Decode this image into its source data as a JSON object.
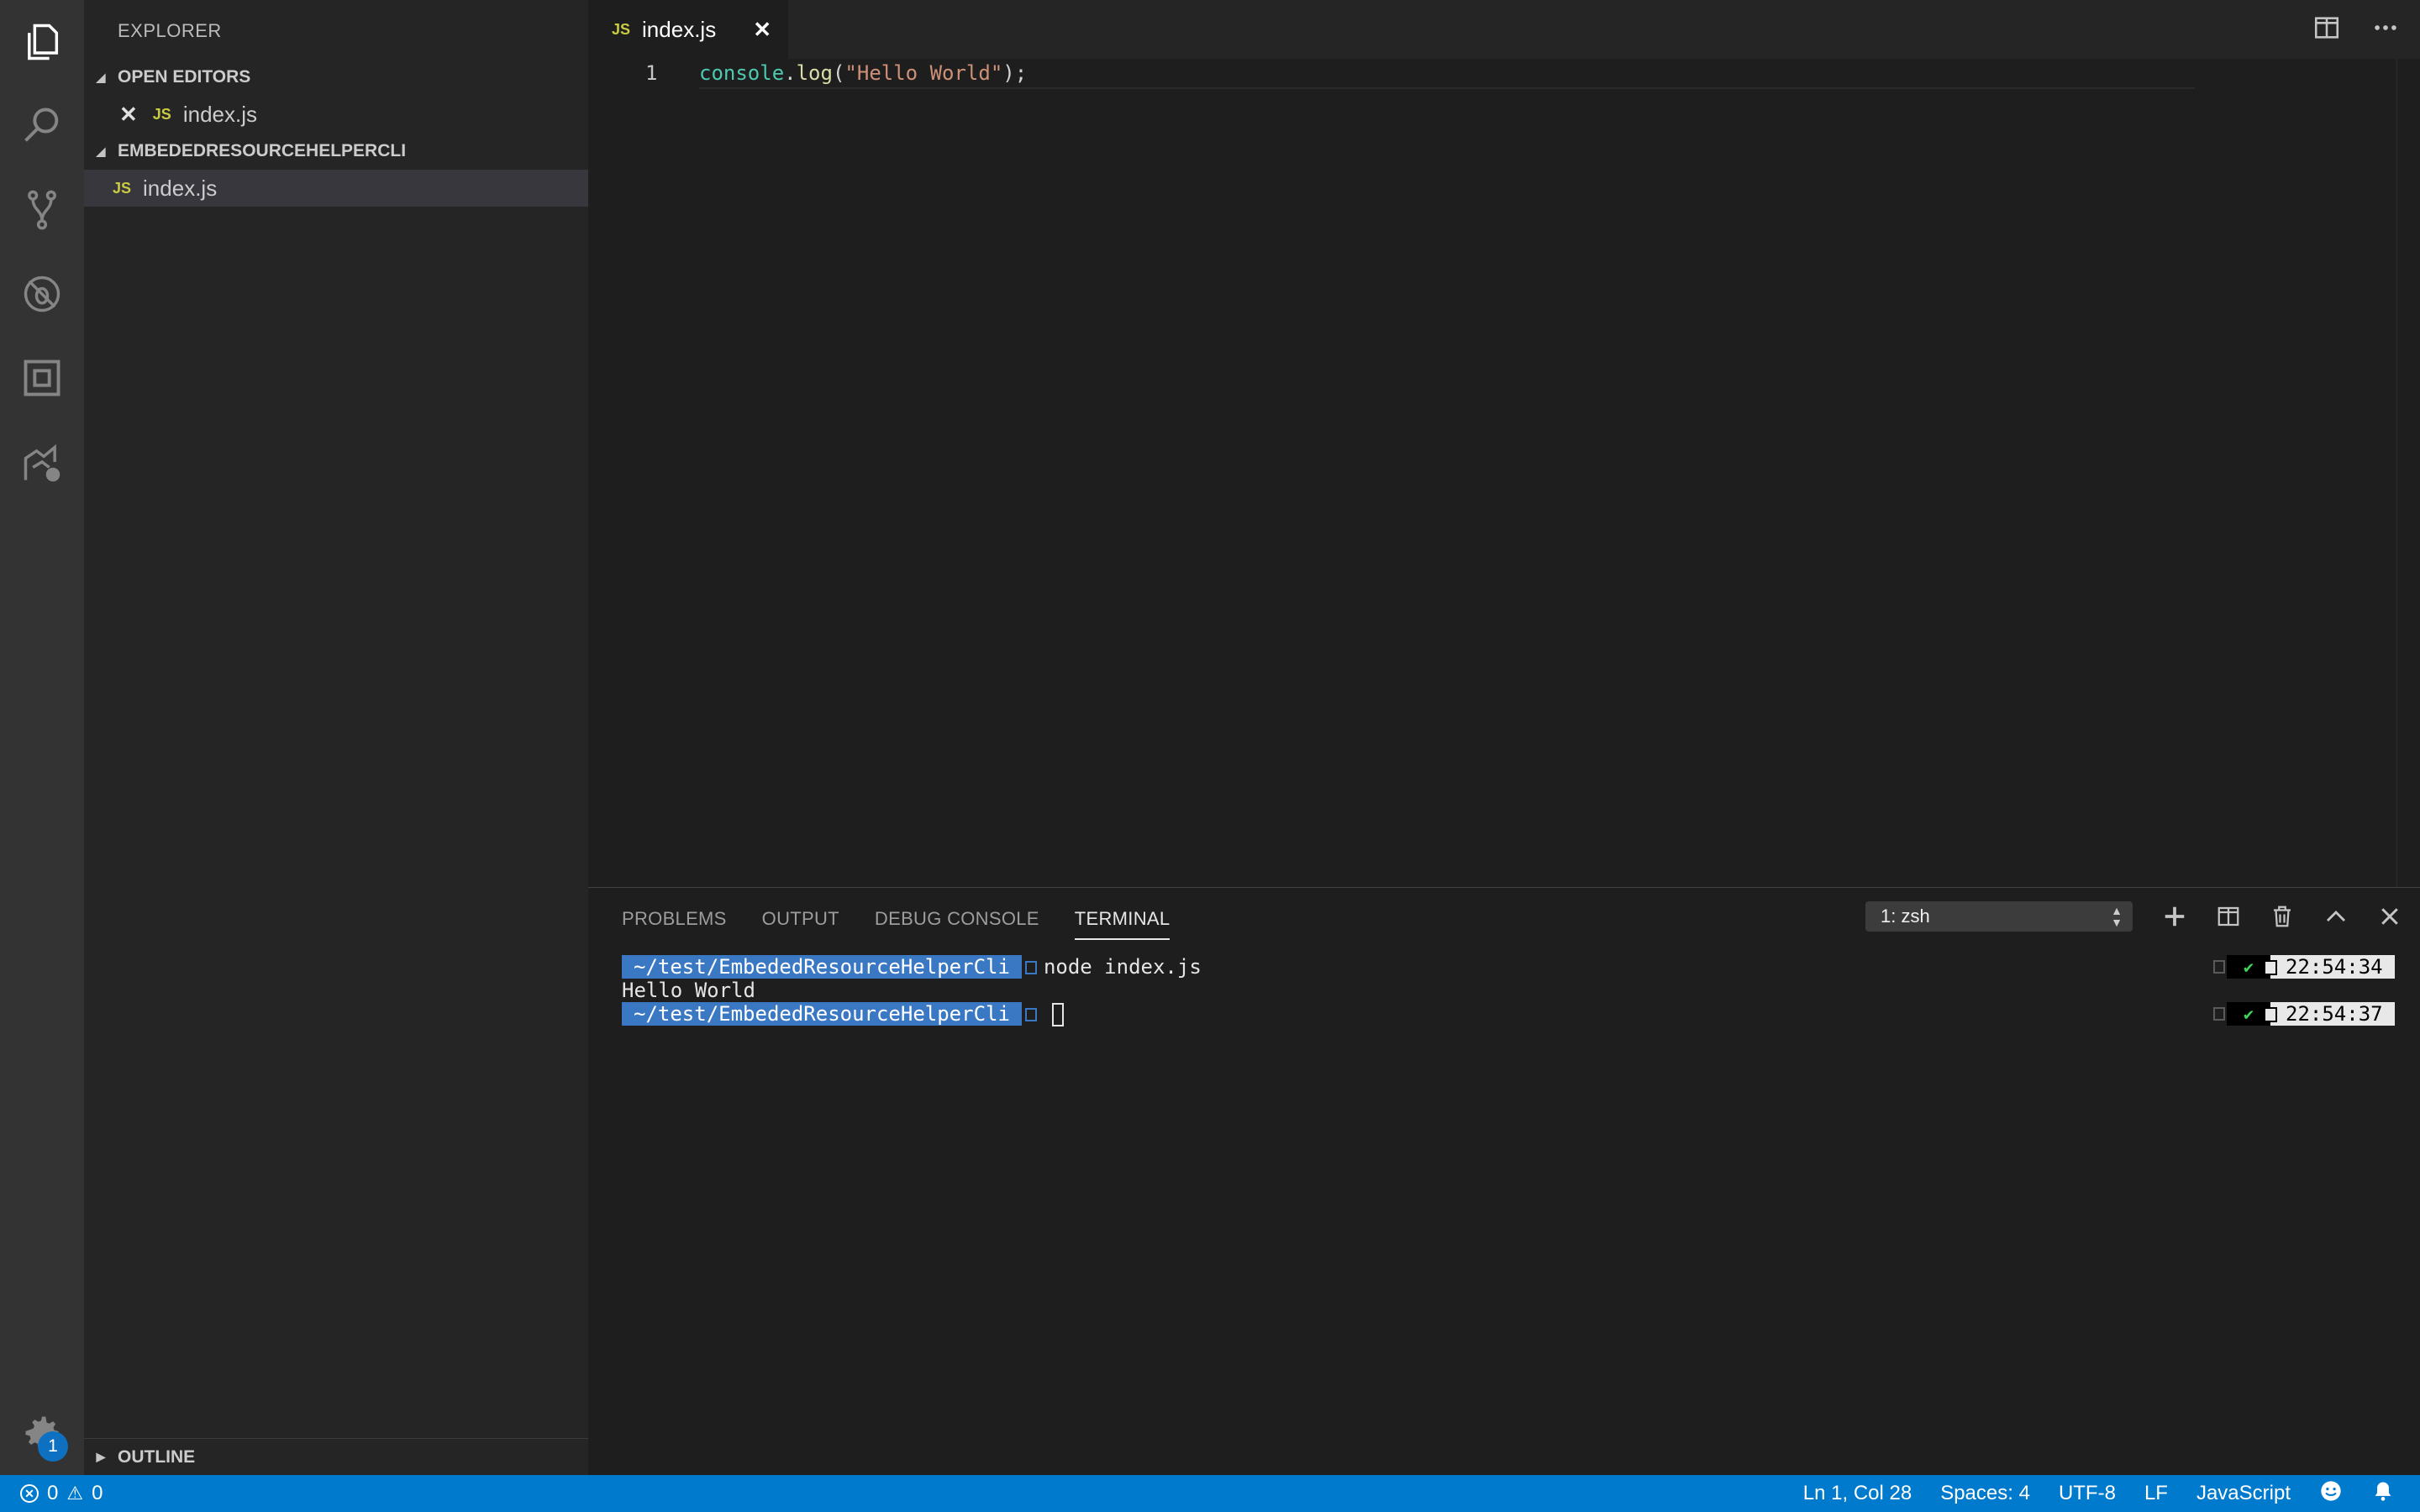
{
  "activity_bar": {
    "items": [
      "explorer-icon",
      "search-icon",
      "source-control-icon",
      "debug-icon",
      "extensions-icon",
      "remote-explorer-icon"
    ],
    "settings_badge": "1"
  },
  "sidebar": {
    "title": "EXPLORER",
    "open_editors": {
      "label": "OPEN EDITORS",
      "items": [
        {
          "lang": "JS",
          "name": "index.js"
        }
      ]
    },
    "project": {
      "label": "EMBEDEDRESOURCEHELPERCLI",
      "items": [
        {
          "lang": "JS",
          "name": "index.js"
        }
      ]
    },
    "outline_label": "OUTLINE"
  },
  "editor": {
    "tab": {
      "lang": "JS",
      "name": "index.js",
      "close": "✕"
    },
    "line_number": "1",
    "code": {
      "object": "console",
      "dot": ".",
      "method": "log",
      "open": "(",
      "string": "\"Hello World\"",
      "close": ");"
    }
  },
  "panel": {
    "tabs": [
      "PROBLEMS",
      "OUTPUT",
      "DEBUG CONSOLE",
      "TERMINAL"
    ],
    "active_tab": "TERMINAL",
    "terminal_select": "1: zsh",
    "terminal": {
      "prompt_path": "~/test/EmbededResourceHelperCli",
      "command": "node index.js",
      "output": "Hello World",
      "check": "✔",
      "time_1": "22:54:34",
      "time_2": "22:54:37"
    }
  },
  "status_bar": {
    "errors": "0",
    "warnings": "0",
    "position": "Ln 1, Col 28",
    "spaces": "Spaces: 4",
    "encoding": "UTF-8",
    "eol": "LF",
    "language": "JavaScript"
  },
  "colors": {
    "accent": "#007acc",
    "activity_bar": "#333333",
    "sidebar": "#252526",
    "editor_bg": "#1e1e1e",
    "prompt_bg": "#3a78c4"
  }
}
